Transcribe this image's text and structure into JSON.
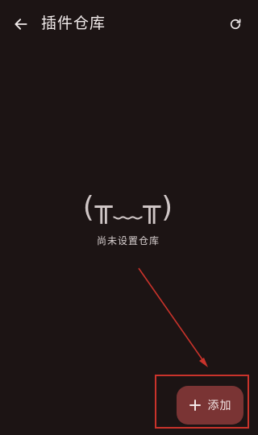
{
  "app_bar": {
    "title": "插件仓库",
    "back_icon": "arrow-left-icon",
    "refresh_icon": "refresh-icon"
  },
  "empty_state": {
    "kaomoji": "(╥﹏╥)",
    "message": "尚未设置仓库"
  },
  "fab": {
    "icon": "plus-icon",
    "label": "添加",
    "color": "#7a3434"
  },
  "annotation": {
    "color": "#c9332b"
  },
  "theme": {
    "background": "#1c1414",
    "text": "#ece6e6"
  }
}
